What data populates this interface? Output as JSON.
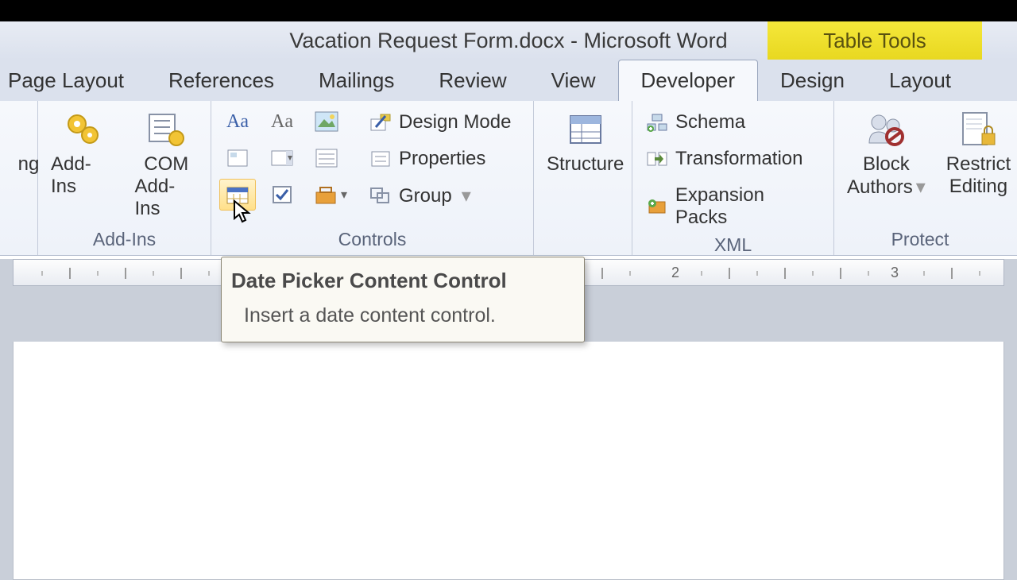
{
  "title": "Vacation Request Form.docx  -  Microsoft Word",
  "contextual_tab": "Table Tools",
  "tabs": [
    "Page Layout",
    "References",
    "Mailings",
    "Review",
    "View",
    "Developer",
    "Design",
    "Layout"
  ],
  "active_tab": 5,
  "groups": {
    "addins_frag": "ng",
    "addins": {
      "label": "Add-Ins",
      "btn1": "Add-Ins",
      "btn2_l1": "COM",
      "btn2_l2": "Add-Ins"
    },
    "controls": {
      "label": "Controls",
      "design_mode": "Design Mode",
      "properties": "Properties",
      "group": "Group"
    },
    "structure": {
      "label": "Structure"
    },
    "xml": {
      "label": "XML",
      "schema": "Schema",
      "transformation": "Transformation",
      "expansion": "Expansion Packs"
    },
    "protect": {
      "label": "Protect",
      "block_l1": "Block",
      "block_l2": "Authors",
      "restrict_l1": "Restrict",
      "restrict_l2": "Editing"
    }
  },
  "tooltip": {
    "title": "Date Picker Content Control",
    "body": "Insert a date content control."
  },
  "ruler": {
    "mark2": "2",
    "mark3": "3"
  }
}
